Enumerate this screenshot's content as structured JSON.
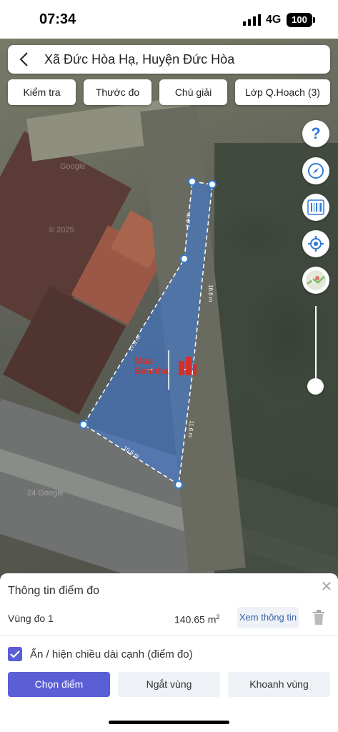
{
  "status_bar": {
    "time": "07:34",
    "network": "4G",
    "battery": "100"
  },
  "header": {
    "title": "Xã Đức Hòa Hạ, Huyện Đức Hòa"
  },
  "toolbar": {
    "check": "Kiểm tra",
    "ruler": "Thước đo",
    "legend": "Chú giải",
    "planning_layer": "Lớp Q.Hoạch (3)"
  },
  "map_controls": {
    "help_icon": "question-icon",
    "compass_icon": "compass-icon",
    "barcode_icon": "barcode-icon",
    "locate_icon": "locate-icon",
    "basemap_icon": "map-thumbnail-icon"
  },
  "measurements": {
    "edge_top": "7.2 m",
    "edge_right_upper": "16.6 m",
    "edge_left": "17.9 m",
    "edge_right_lower": "11.6 m",
    "edge_bottom": "10.6 m",
    "accent": "#2f7bd8"
  },
  "watermark": {
    "line1": "Mua",
    "line2": "Bannha",
    "suffix": ".vn",
    "color": "#d62e28"
  },
  "map_watermarks": {
    "copyright": "© 2025",
    "google1": "Google",
    "google2": "Google",
    "year2": "24 Google"
  },
  "panel": {
    "title": "Thông tin điểm đo",
    "area_label": "Vùng đo 1",
    "area_value": "140.65 m",
    "area_unit_sup": "2",
    "info_button": "Xem thông tin",
    "toggle_label": "Ẩn / hiện chiều dài cạnh (điểm đo)",
    "toggle_checked": true,
    "btn_select": "Chọn điểm",
    "btn_break": "Ngắt vùng",
    "btn_enclose": "Khoanh vùng",
    "accent": "#5b5fd6"
  }
}
